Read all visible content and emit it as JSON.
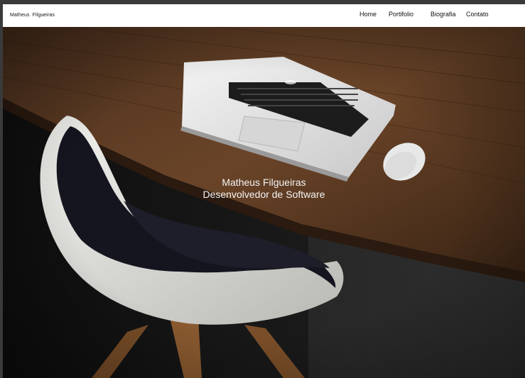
{
  "header": {
    "brand": "Matheus  Filgueiras",
    "nav": [
      {
        "label": "Home"
      },
      {
        "label": "Portifolio"
      },
      {
        "label": "Biografia"
      },
      {
        "label": "Contato"
      }
    ]
  },
  "hero": {
    "name": "Matheus Filgueiras",
    "role": "Desenvolvedor de Software"
  },
  "colors": {
    "navbar_bg": "#ffffff",
    "hero_text": "#f4f4f4",
    "desk": "#5a3a24"
  }
}
